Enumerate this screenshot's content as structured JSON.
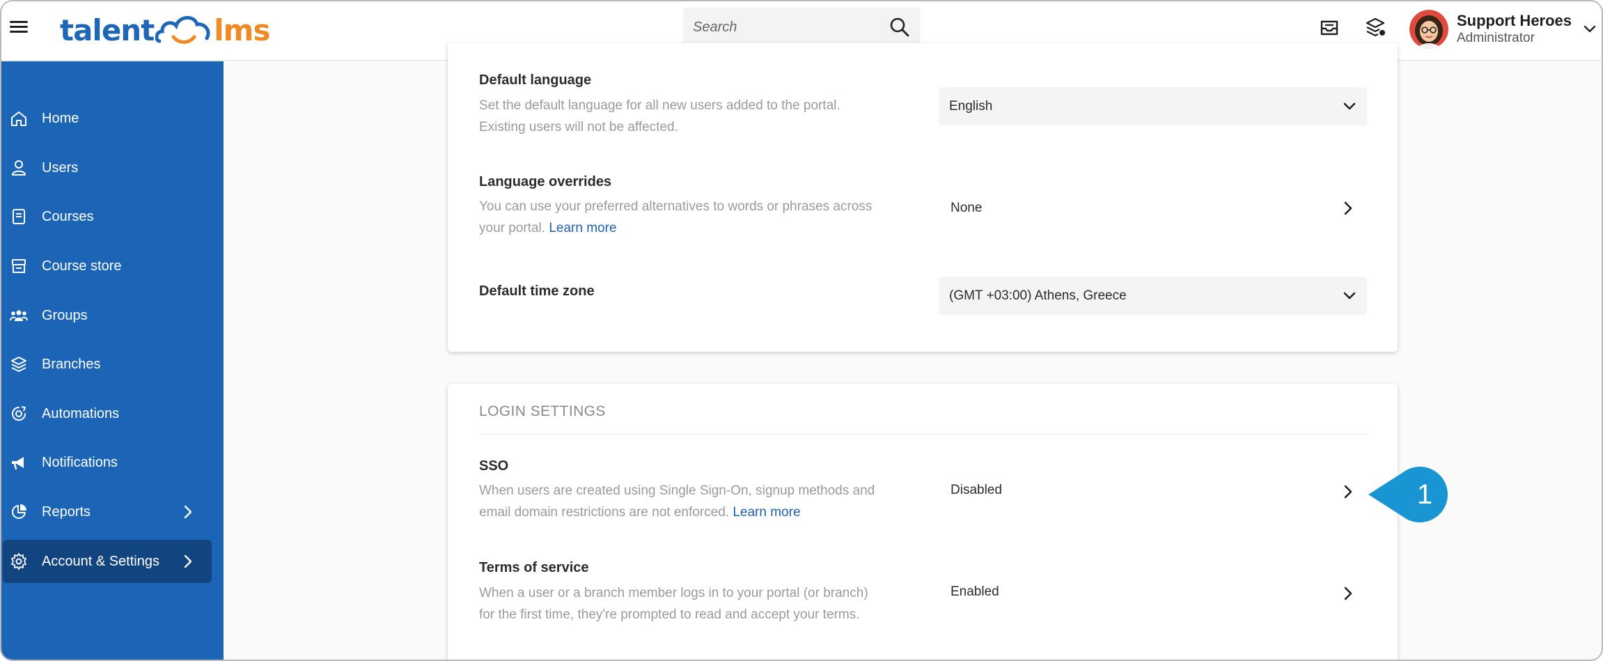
{
  "app": {
    "logo_left": "talent",
    "logo_right": "lms"
  },
  "search": {
    "placeholder": "Search"
  },
  "user": {
    "name": "Support Heroes",
    "role": "Administrator"
  },
  "sidebar": {
    "items": [
      {
        "label": "Home",
        "icon": "home-icon"
      },
      {
        "label": "Users",
        "icon": "user-icon"
      },
      {
        "label": "Courses",
        "icon": "book-icon"
      },
      {
        "label": "Course store",
        "icon": "store-icon"
      },
      {
        "label": "Groups",
        "icon": "groups-icon"
      },
      {
        "label": "Branches",
        "icon": "layers-icon"
      },
      {
        "label": "Automations",
        "icon": "automation-icon"
      },
      {
        "label": "Notifications",
        "icon": "megaphone-icon"
      },
      {
        "label": "Reports",
        "icon": "pie-chart-icon"
      },
      {
        "label": "Account & Settings",
        "icon": "gear-icon"
      }
    ]
  },
  "general": {
    "default_language": {
      "title": "Default language",
      "desc_line1": "Set the default language for all new users added to the portal.",
      "desc_line2": "Existing users will not be affected.",
      "value": "English"
    },
    "language_overrides": {
      "title": "Language overrides",
      "desc_line1": "You can use your preferred alternatives to words or phrases across",
      "desc_line2": "your portal.",
      "link": "Learn more",
      "value": "None"
    },
    "time_zone": {
      "title": "Default time zone",
      "value": "(GMT +03:00) Athens, Greece"
    }
  },
  "login": {
    "section_title": "LOGIN SETTINGS",
    "sso": {
      "title": "SSO",
      "desc_line1": "When users are created using Single Sign-On, signup methods and",
      "desc_line2": "email domain restrictions are not enforced.",
      "link": "Learn more",
      "value": "Disabled"
    },
    "terms": {
      "title": "Terms of service",
      "desc_line1": "When a user or a branch member logs in to your portal (or branch)",
      "desc_line2": "for the first time, they're prompted to read and accept your terms.",
      "value": "Enabled"
    }
  },
  "callout": {
    "number": "1",
    "color": "#1a95d4"
  },
  "colors": {
    "sidebar": "#1c65b6",
    "sidebar_active": "#124580",
    "link": "#1f5fab",
    "logo_orange": "#f08a24"
  }
}
